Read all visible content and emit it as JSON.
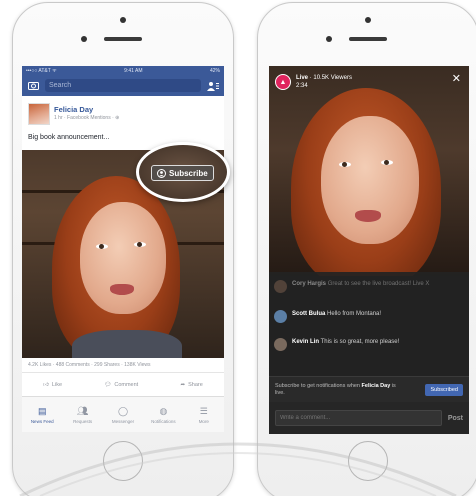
{
  "left_phone": {
    "status_bar": {
      "carrier": "•••○○ AT&T ᯤ",
      "time": "9:41 AM",
      "battery": "42%"
    },
    "search": {
      "placeholder": "Search"
    },
    "post": {
      "author": "Felicia Day",
      "meta": "1 hr · Facebook Mentions · ⊕",
      "text": "Big book announcement..."
    },
    "subscribe_label": "Subscribe",
    "stats": "4.2K Likes · 488 Comments · 299 Shares · 138K Views",
    "actions": {
      "like": "Like",
      "comment": "Comment",
      "share": "Share"
    },
    "tabs": [
      {
        "label": "News Feed",
        "icon": "news-feed-icon"
      },
      {
        "label": "Requests",
        "icon": "friends-icon"
      },
      {
        "label": "Messenger",
        "icon": "messenger-icon"
      },
      {
        "label": "Notifications",
        "icon": "globe-icon"
      },
      {
        "label": "More",
        "icon": "menu-icon"
      }
    ]
  },
  "right_phone": {
    "live": {
      "badge": "Live",
      "viewers": "10.5K Viewers",
      "duration": "2:34"
    },
    "comments": [
      {
        "name": "Cory Hargis",
        "text": "Great to see the live broadcast! Live X"
      },
      {
        "name": "Scott Bulua",
        "text": "Hello from Montana!"
      },
      {
        "name": "Kevin Lin",
        "text": "This is so great, more please!"
      }
    ],
    "notify": {
      "prefix": "Subscribe to get notifications when",
      "name": "Felicia Day",
      "suffix": "is live.",
      "button": "Subscribed"
    },
    "composer": {
      "placeholder": "Write a comment...",
      "post_label": "Post"
    }
  }
}
